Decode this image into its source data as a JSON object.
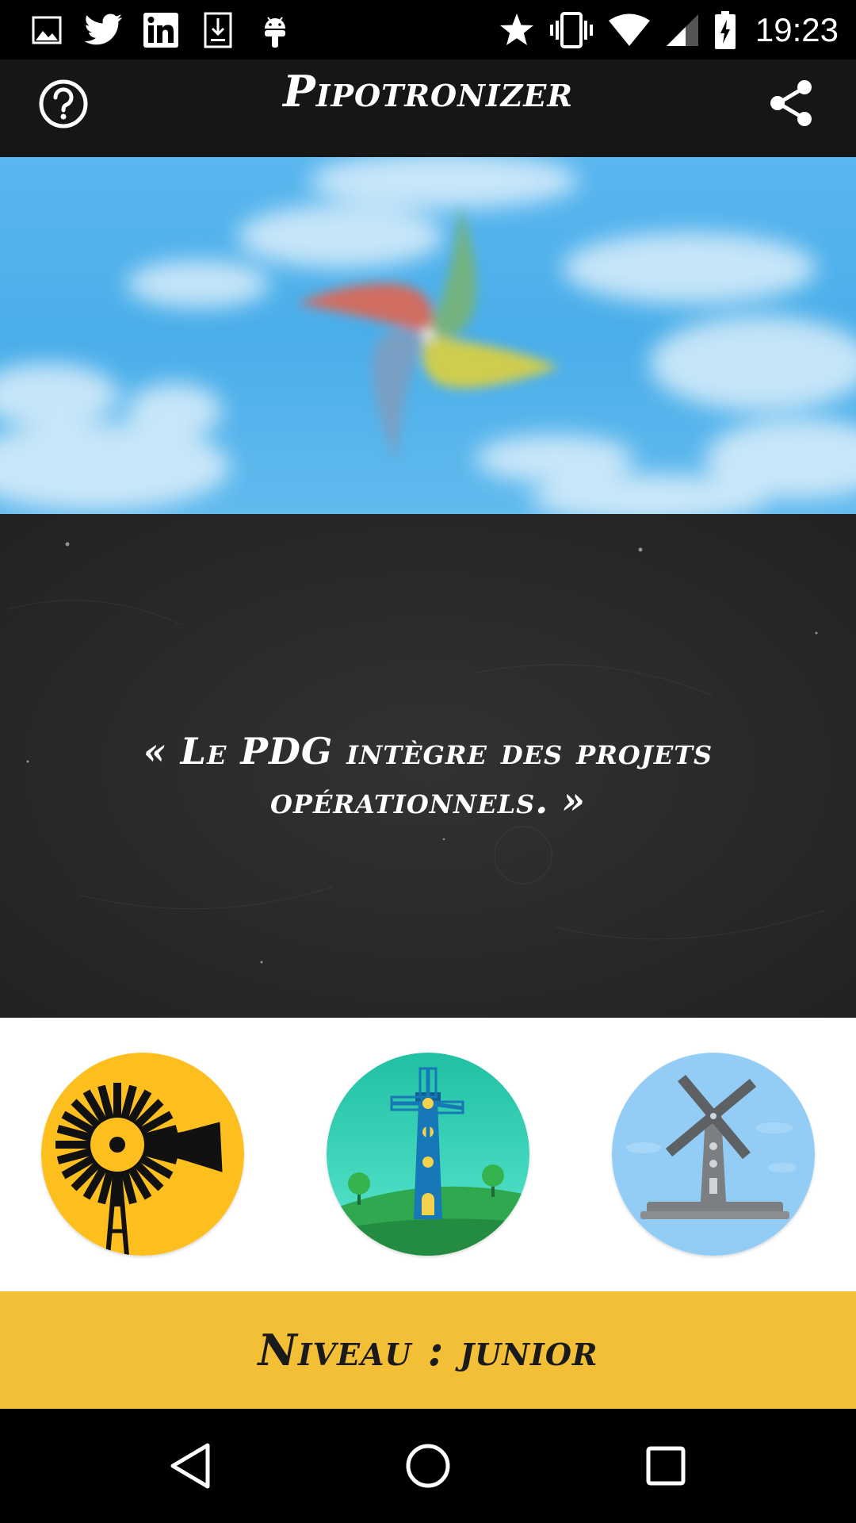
{
  "status_bar": {
    "time": "19:23",
    "left_icons": [
      "image-icon",
      "twitter-icon",
      "linkedin-icon",
      "download-icon",
      "android-icon"
    ],
    "right_icons": [
      "star-icon",
      "vibrate-icon",
      "wifi-icon",
      "signal-icon",
      "battery-charging-icon"
    ]
  },
  "app_bar": {
    "title": "Pipotronizer",
    "help_icon": "help-circle-icon",
    "share_icon": "share-icon"
  },
  "quote": {
    "line1": "« Le PDG intègre des projets",
    "line2": "opérationnels. »"
  },
  "levels": {
    "items": [
      "windpump-level-icon",
      "lighthouse-mill-level-icon",
      "windmill-level-icon"
    ]
  },
  "level_bar": {
    "text": "Niveau : junior"
  },
  "nav_bar": {
    "icons": [
      "back-icon",
      "home-icon",
      "recents-icon"
    ]
  },
  "colors": {
    "status_bg": "#000000",
    "appbar_bg": "#161616",
    "sky": "#4aaee9",
    "board": "#2a2a2a",
    "level_bar": "#f3bf36",
    "text_light": "#ffffff",
    "text_dark": "#1a1a1a"
  }
}
